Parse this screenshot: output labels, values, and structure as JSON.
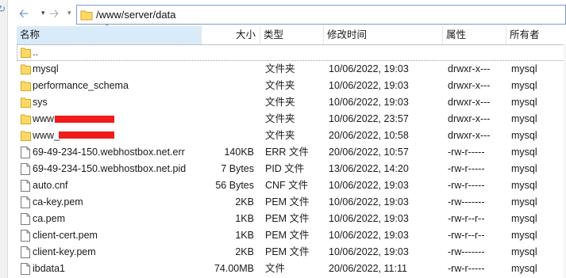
{
  "toolbar": {
    "path": "/www/server/data"
  },
  "columns": {
    "name": "名称",
    "size": "大小",
    "type": "类型",
    "modified": "修改时间",
    "attributes": "属性",
    "owner": "所有者"
  },
  "rows": [
    {
      "name": "..",
      "size": "",
      "type": "",
      "modified": "",
      "attributes": "",
      "owner": "",
      "icon": "folder-icon"
    },
    {
      "name": "mysql",
      "size": "",
      "type": "文件夹",
      "modified": "10/06/2022, 19:03",
      "attributes": "drwxr-x---",
      "owner": "mysql",
      "icon": "folder-icon"
    },
    {
      "name": "performance_schema",
      "size": "",
      "type": "文件夹",
      "modified": "10/06/2022, 19:03",
      "attributes": "drwxr-x---",
      "owner": "mysql",
      "icon": "folder-icon"
    },
    {
      "name": "sys",
      "size": "",
      "type": "文件夹",
      "modified": "10/06/2022, 19:03",
      "attributes": "drwxr-x---",
      "owner": "mysql",
      "icon": "folder-icon"
    },
    {
      "name": "www",
      "size": "",
      "type": "文件夹",
      "modified": "10/06/2022, 23:57",
      "attributes": "drwxr-x---",
      "owner": "mysql",
      "icon": "folder-icon"
    },
    {
      "name": "www_",
      "size": "",
      "type": "文件夹",
      "modified": "20/06/2022, 10:58",
      "attributes": "drwxr-x---",
      "owner": "mysql",
      "icon": "folder-icon"
    },
    {
      "name": "69-49-234-150.webhostbox.net.err",
      "size": "140KB",
      "type": "ERR 文件",
      "modified": "20/06/2022, 10:57",
      "attributes": "-rw-r-----",
      "owner": "mysql",
      "icon": "file-icon"
    },
    {
      "name": "69-49-234-150.webhostbox.net.pid",
      "size": "7 Bytes",
      "type": "PID 文件",
      "modified": "13/06/2022, 14:20",
      "attributes": "-rw-r-----",
      "owner": "mysql",
      "icon": "file-icon"
    },
    {
      "name": "auto.cnf",
      "size": "56 Bytes",
      "type": "CNF 文件",
      "modified": "10/06/2022, 19:03",
      "attributes": "-rw-r-----",
      "owner": "mysql",
      "icon": "file-icon"
    },
    {
      "name": "ca-key.pem",
      "size": "2KB",
      "type": "PEM 文件",
      "modified": "10/06/2022, 19:03",
      "attributes": "-rw-------",
      "owner": "mysql",
      "icon": "file-icon"
    },
    {
      "name": "ca.pem",
      "size": "1KB",
      "type": "PEM 文件",
      "modified": "10/06/2022, 19:03",
      "attributes": "-rw-r--r--",
      "owner": "mysql",
      "icon": "file-icon"
    },
    {
      "name": "client-cert.pem",
      "size": "1KB",
      "type": "PEM 文件",
      "modified": "10/06/2022, 19:03",
      "attributes": "-rw-r--r--",
      "owner": "mysql",
      "icon": "file-icon"
    },
    {
      "name": "client-key.pem",
      "size": "2KB",
      "type": "PEM 文件",
      "modified": "10/06/2022, 19:03",
      "attributes": "-rw-------",
      "owner": "mysql",
      "icon": "file-icon"
    },
    {
      "name": "ibdata1",
      "size": "74.00MB",
      "type": "文件",
      "modified": "20/06/2022, 11:11",
      "attributes": "-rw-r-----",
      "owner": "mysql",
      "icon": "file-icon"
    }
  ],
  "colors": {
    "header_sorted_bg": "#d9ebf9",
    "folder_yellow": "#ffd966",
    "redaction": "#f01b1b"
  }
}
